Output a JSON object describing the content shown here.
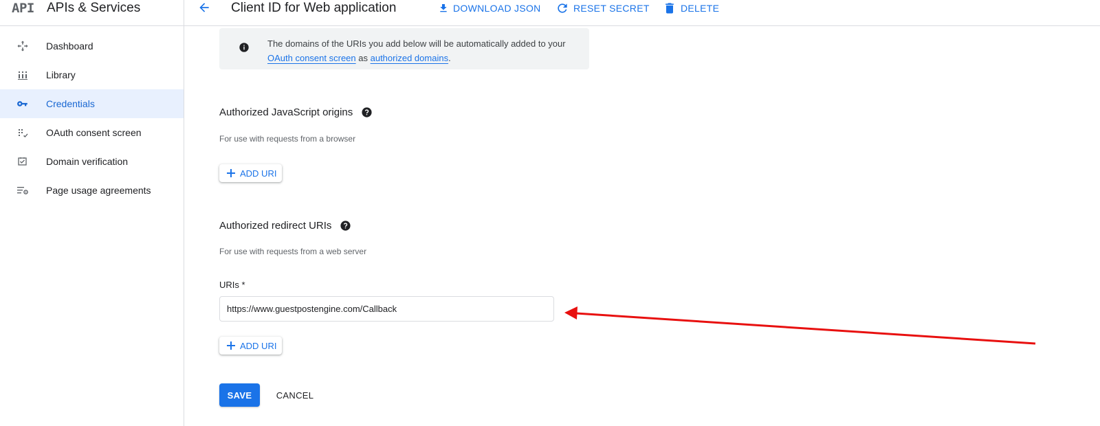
{
  "header": {
    "logo_text": "API",
    "product_title": "APIs & Services",
    "page_title": "Client ID for Web application",
    "actions": {
      "download": "DOWNLOAD JSON",
      "reset": "RESET SECRET",
      "delete": "DELETE"
    }
  },
  "sidebar": {
    "items": [
      {
        "label": "Dashboard",
        "icon": "dashboard-icon",
        "active": false
      },
      {
        "label": "Library",
        "icon": "library-icon",
        "active": false
      },
      {
        "label": "Credentials",
        "icon": "key-icon",
        "active": true
      },
      {
        "label": "OAuth consent screen",
        "icon": "consent-icon",
        "active": false
      },
      {
        "label": "Domain verification",
        "icon": "checkbox-icon",
        "active": false
      },
      {
        "label": "Page usage agreements",
        "icon": "settings-list-icon",
        "active": false
      }
    ]
  },
  "info": {
    "text_before": "The domains of the URIs you add below will be automatically added to your ",
    "link1": "OAuth consent screen",
    "text_middle": " as ",
    "link2": "authorized domains",
    "text_after": "."
  },
  "js_origins": {
    "title": "Authorized JavaScript origins",
    "description": "For use with requests from a browser",
    "add_label": "ADD URI"
  },
  "redirect_uris": {
    "title": "Authorized redirect URIs",
    "description": "For use with requests from a web server",
    "field_label": "URIs *",
    "uri_value": "https://www.guestpostengine.com/Callback",
    "add_label": "ADD URI"
  },
  "form": {
    "save_label": "SAVE",
    "cancel_label": "CANCEL"
  },
  "colors": {
    "accent": "#1a73e8",
    "active_bg": "#e8f0fe",
    "annotation_arrow": "#e8100f"
  }
}
